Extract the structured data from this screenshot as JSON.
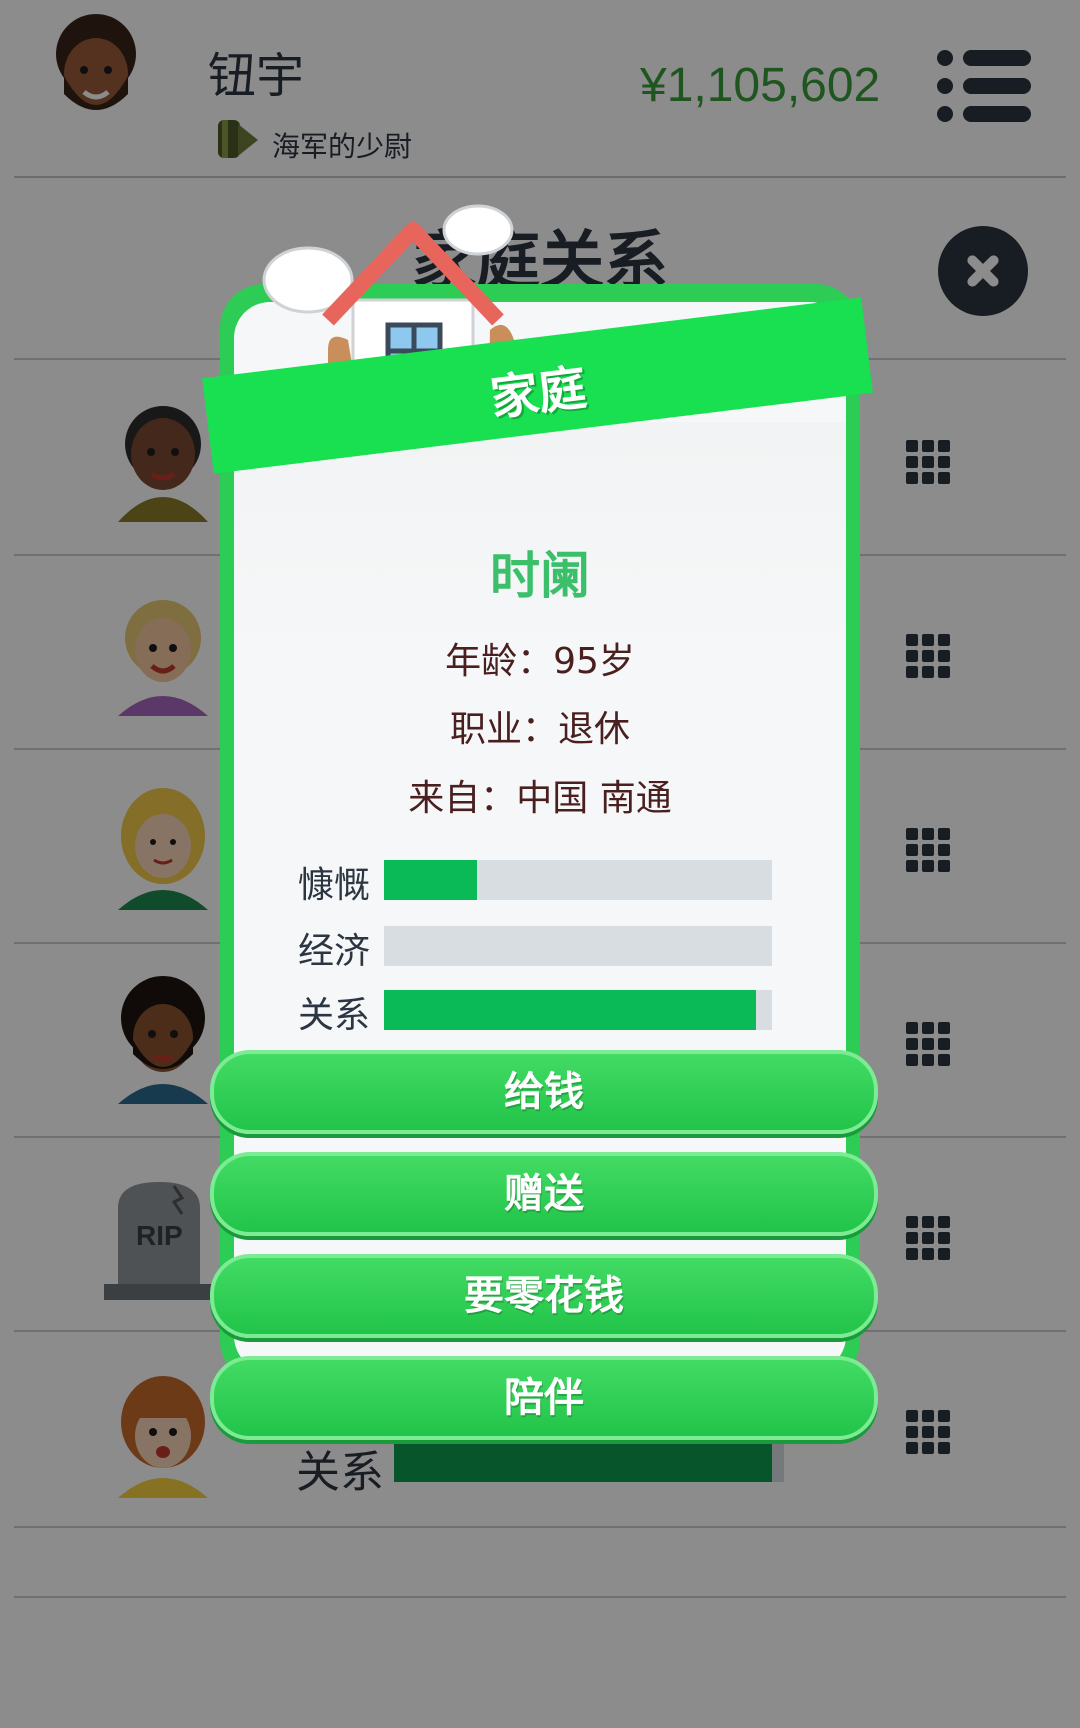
{
  "header": {
    "player_name": "钮宇",
    "rank": "海军的少尉",
    "money": "¥1,105,602"
  },
  "page": {
    "title": "家庭关系"
  },
  "background_rows": [
    {
      "avatar": "man-dark-avatar"
    },
    {
      "avatar": "woman-blonde-ponytail-avatar"
    },
    {
      "avatar": "woman-blonde-avatar"
    },
    {
      "avatar": "man-curly-beard-avatar"
    },
    {
      "avatar": "rip-tombstone",
      "text": "RIP"
    },
    {
      "avatar": "girl-bangs-avatar"
    }
  ],
  "background_stat": {
    "label": "关系",
    "value": 0.97
  },
  "modal": {
    "banner": "家庭",
    "name": "时阑",
    "age": "年龄：95岁",
    "job": "职业：退休",
    "origin": "来自：中国 南通",
    "stats": [
      {
        "label": "慷慨",
        "value": 0.24
      },
      {
        "label": "经济",
        "value": 0.0
      },
      {
        "label": "关系",
        "value": 0.96
      }
    ],
    "buttons": [
      "给钱",
      "赠送",
      "要零花钱",
      "陪伴"
    ]
  },
  "colors": {
    "accent_green": "#2ccc55",
    "stat_green": "#0aba57",
    "money_green": "#3a9b3a",
    "dark_text": "#2c3542"
  }
}
